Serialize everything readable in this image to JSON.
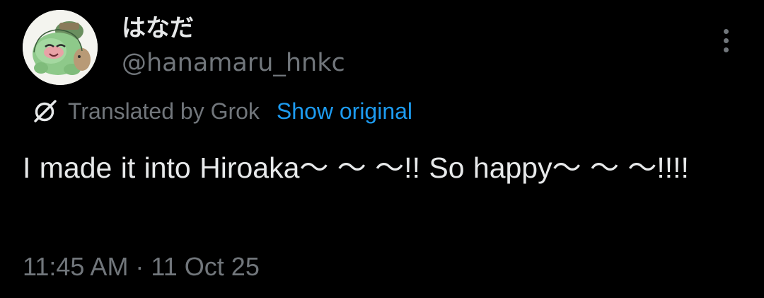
{
  "author": {
    "display_name": "はなだ",
    "handle": "@hanamaru_hnkc"
  },
  "translation": {
    "label": "Translated by Grok",
    "show_original": "Show original"
  },
  "post": {
    "text": "I made it into Hiroaka～ ～ ～!! So happy～ ～ ～!!!!",
    "timestamp": "11:45 AM · 11 Oct 25"
  },
  "icons": {
    "more": "more-vertical-icon",
    "translate": "grok-icon",
    "avatar": "avatar"
  },
  "colors": {
    "background": "#000000",
    "primary_text": "#e7e9ea",
    "secondary_text": "#71767b",
    "link": "#1d9bf0"
  }
}
